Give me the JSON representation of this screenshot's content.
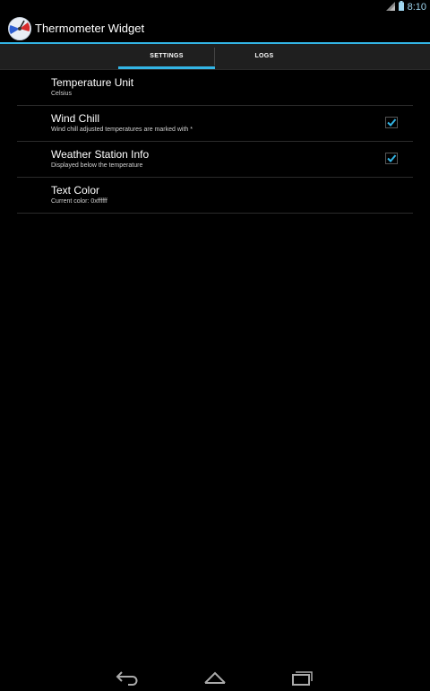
{
  "status_bar": {
    "time": "8:10",
    "icons": [
      "signal-icon",
      "battery-icon"
    ],
    "accent": "#9fd5ee"
  },
  "app": {
    "title": "Thermometer Widget",
    "icon": "thermometer-gauge-icon"
  },
  "tabs": [
    {
      "label": "SETTINGS",
      "selected": true
    },
    {
      "label": "LOGS",
      "selected": false
    }
  ],
  "preferences": [
    {
      "title": "Temperature Unit",
      "summary": "Celsius",
      "checkbox": false
    },
    {
      "title": "Wind Chill",
      "summary": "Wind chill adjusted temperatures are marked with *",
      "checkbox": true,
      "checked": true
    },
    {
      "title": "Weather Station Info",
      "summary": "Displayed below the temperature",
      "checkbox": true,
      "checked": true
    },
    {
      "title": "Text Color",
      "summary": "Current color: 0xffffff",
      "checkbox": false
    }
  ],
  "nav_bar": {
    "buttons": [
      "back-icon",
      "home-icon",
      "recents-icon"
    ]
  },
  "colors": {
    "accent": "#33b5e5",
    "background": "#000000",
    "tab_bar": "#1f1f1f"
  }
}
